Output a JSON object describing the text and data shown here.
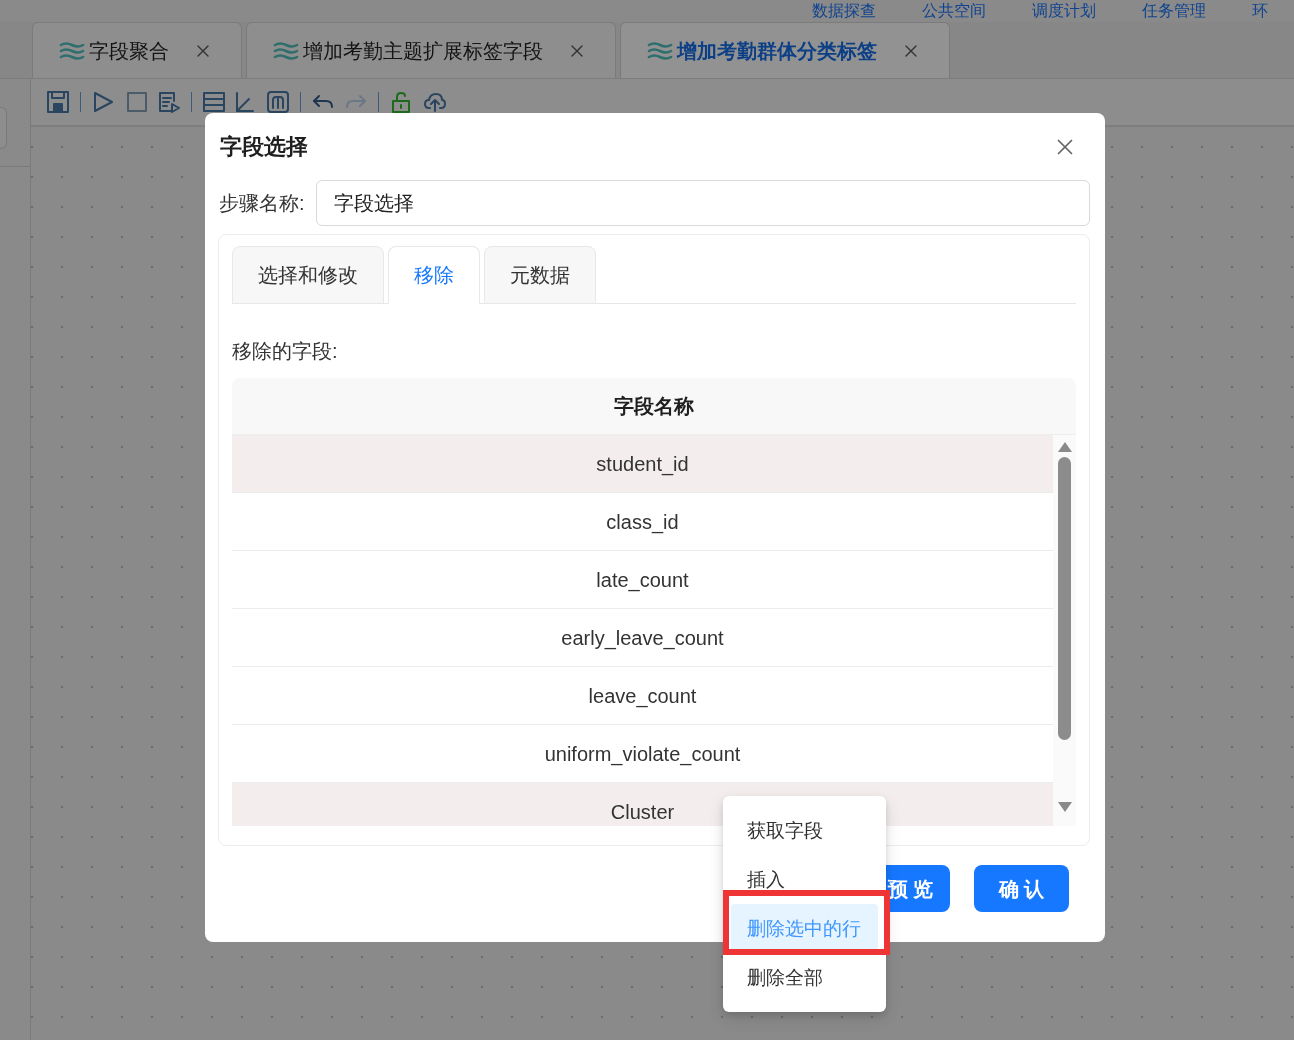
{
  "top_nav": {
    "items": [
      "数据探查",
      "公共空间",
      "调度计划",
      "任务管理",
      "环"
    ]
  },
  "editor_tabs": [
    {
      "label": "字段聚合",
      "selected": false
    },
    {
      "label": "增加考勤主题扩展标签字段",
      "selected": false
    },
    {
      "label": "增加考勤群体分类标签",
      "selected": true
    }
  ],
  "dialog": {
    "title": "字段选择",
    "step_name": {
      "label": "步骤名称:",
      "value": "字段选择"
    },
    "tabs": [
      {
        "label": "选择和修改",
        "selected": false
      },
      {
        "label": "移除",
        "selected": true
      },
      {
        "label": "元数据",
        "selected": false
      }
    ],
    "section_label": "移除的字段:",
    "table": {
      "columns": [
        "字段名称"
      ],
      "rows": [
        {
          "name": "student_id",
          "selected": true
        },
        {
          "name": "class_id",
          "selected": false
        },
        {
          "name": "late_count",
          "selected": false
        },
        {
          "name": "early_leave_count",
          "selected": false
        },
        {
          "name": "leave_count",
          "selected": false
        },
        {
          "name": "uniform_violate_count",
          "selected": false
        },
        {
          "name": "Cluster",
          "selected": true
        }
      ]
    },
    "buttons": [
      {
        "label": "预 览"
      },
      {
        "label": "确 认"
      }
    ]
  },
  "context_menu": {
    "items": [
      {
        "label": "获取字段",
        "selected": false,
        "outlined": false
      },
      {
        "label": "插入",
        "selected": false,
        "outlined": false
      },
      {
        "label": "删除选中的行",
        "selected": true,
        "outlined": true
      },
      {
        "label": "删除全部",
        "selected": false,
        "outlined": false
      }
    ]
  }
}
